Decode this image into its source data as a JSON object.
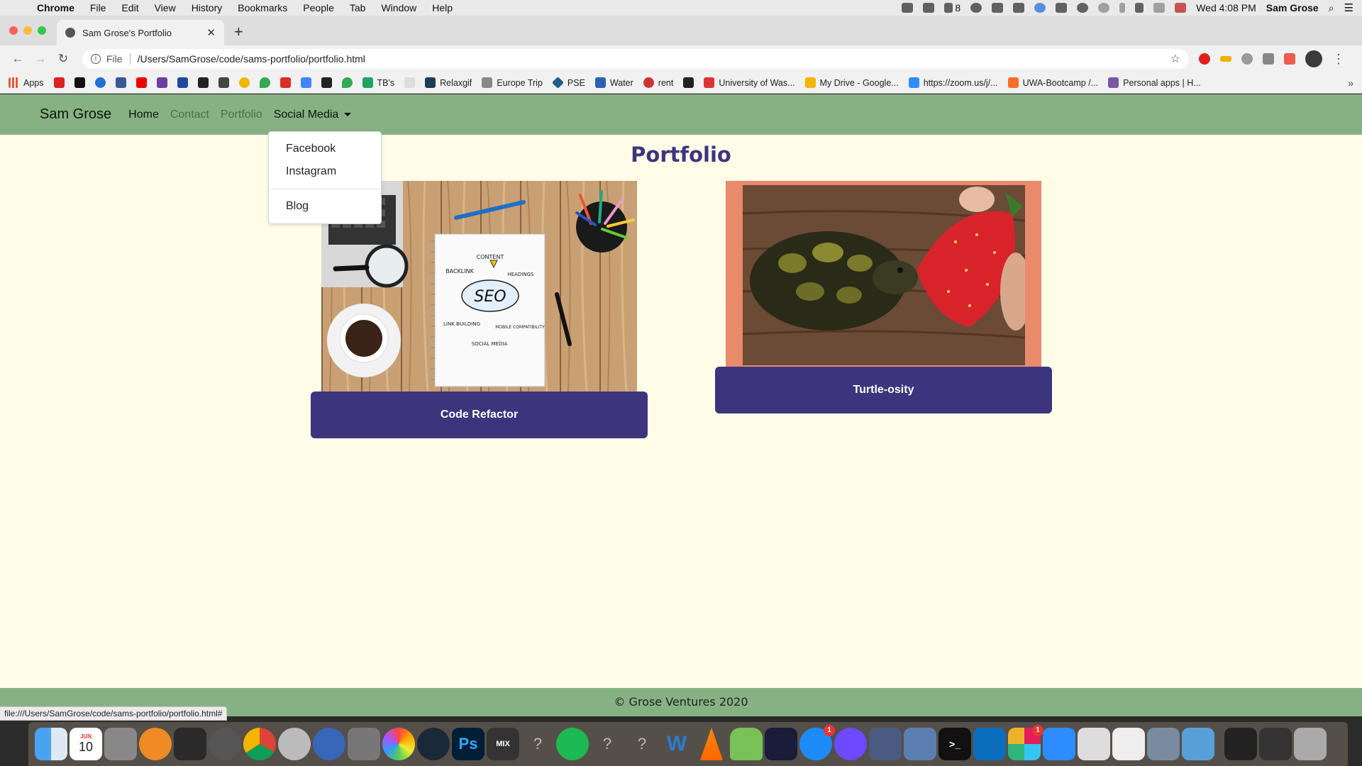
{
  "menubar": {
    "app_name": "Chrome",
    "items": [
      "File",
      "Edit",
      "View",
      "History",
      "Bookmarks",
      "People",
      "Tab",
      "Window",
      "Help"
    ],
    "adobe_count": "8",
    "datetime": "Wed 4:08 PM",
    "user": "Sam Grose"
  },
  "browser": {
    "tab_title": "Sam Grose's Portfolio",
    "scheme_label": "File",
    "url": "/Users/SamGrose/code/sams-portfolio/portfolio.html",
    "status_url": "file:///Users/SamGrose/code/sams-portfolio/portfolio.html#"
  },
  "bookmarks": {
    "apps": "Apps",
    "tbs": "TB's",
    "relaxgif": "Relaxgif",
    "europe": "Europe Trip",
    "pse": "PSE",
    "water": "Water",
    "rent": "rent",
    "uw": "University of Was...",
    "drive": "My Drive - Google...",
    "zoom": "https://zoom.us/j/...",
    "uwa": "UWA-Bootcamp /...",
    "personal": "Personal apps | H..."
  },
  "site": {
    "brand": "Sam Grose",
    "nav": {
      "home": "Home",
      "contact": "Contact",
      "portfolio": "Portfolio",
      "social": "Social Media"
    },
    "dropdown": {
      "facebook": "Facebook",
      "instagram": "Instagram",
      "blog": "Blog"
    },
    "page_title": "Portfolio",
    "projects": [
      {
        "button": "Code Refactor",
        "image_text": [
          "CONTENT",
          "BACKLINK",
          "HEADINGS",
          "SEO",
          "LINK BUILDING",
          "MOBILE COMPATIBILITY",
          "SOCIAL MEDIA"
        ]
      },
      {
        "button": "Turtle-osity"
      }
    ],
    "footer": "© Grose Ventures 2020"
  },
  "dock": {
    "calendar_month": "JUN",
    "calendar_day": "10",
    "photoshop": "Ps",
    "mix": "MIX",
    "word": "W",
    "appstore_badge": "1",
    "slack_badge": "1"
  },
  "colors": {
    "nav_bg": "#86b283",
    "page_bg": "#fffde8",
    "accent": "#3c357d",
    "title": "#3d3580"
  }
}
